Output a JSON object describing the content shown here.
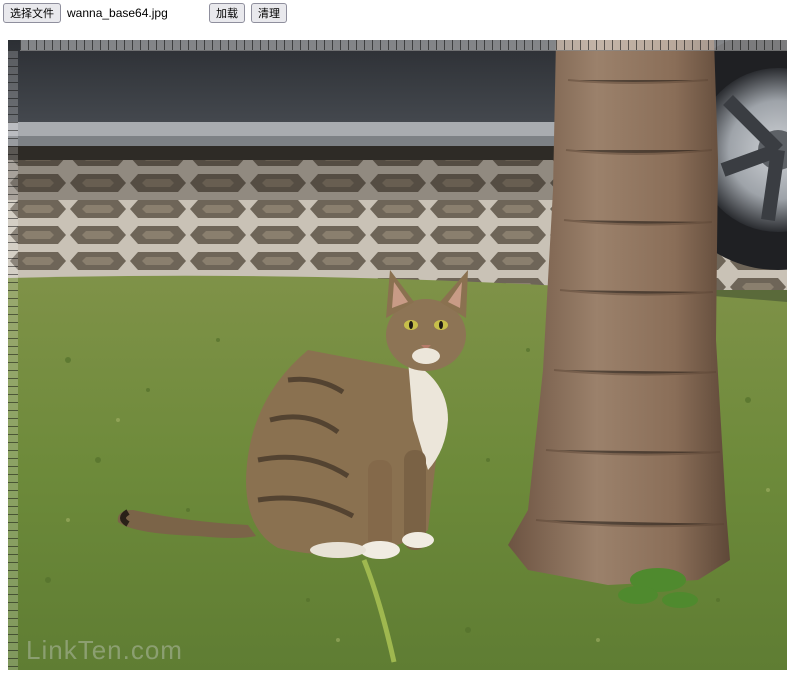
{
  "toolbar": {
    "choose_file_label": "选择文件",
    "file_name": "wanna_base64.jpg",
    "load_label": "加载",
    "clear_label": "清理"
  },
  "image": {
    "subject": "tabby cat sitting on grass beside a tree trunk, car in background",
    "watermark_text": "LinkTen.com",
    "colors": {
      "grass": "#6f8a3d",
      "car": "#3a3d42",
      "trunk": "#8b6f57",
      "pavement": "#b9b2a6"
    }
  }
}
